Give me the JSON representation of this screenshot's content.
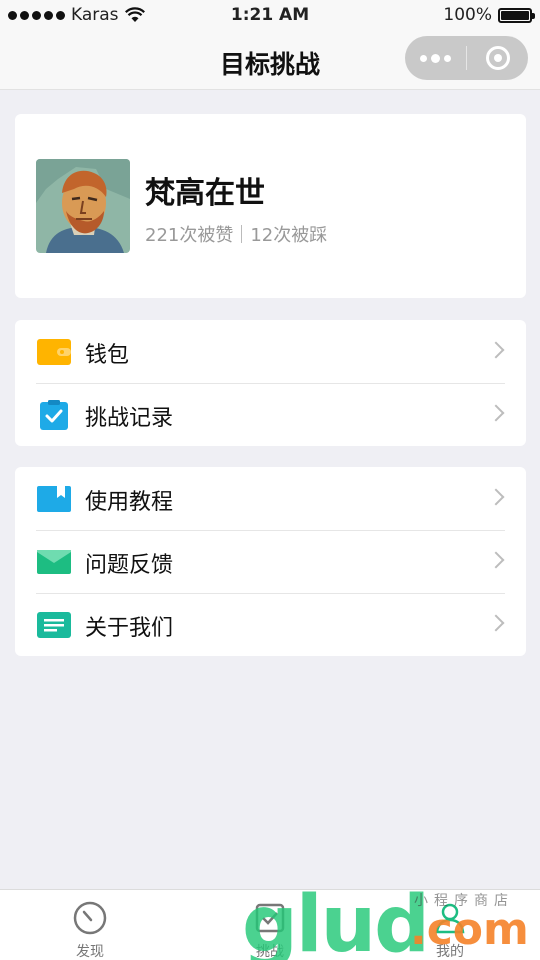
{
  "status_bar": {
    "carrier": "Karas",
    "time": "1:21 AM",
    "battery": "100%",
    "battery_level": 1.0
  },
  "nav": {
    "title": "目标挑战"
  },
  "profile": {
    "name": "梵高在世",
    "likes": "221次被赞",
    "dislikes": "12次被踩"
  },
  "menu_group_1": [
    {
      "label": "钱包",
      "icon": "wallet-icon",
      "color": "#ffb400"
    },
    {
      "label": "挑战记录",
      "icon": "clipboard-check-icon",
      "color": "#1eaae7"
    }
  ],
  "menu_group_2": [
    {
      "label": "使用教程",
      "icon": "book-icon",
      "color": "#1eaae7"
    },
    {
      "label": "问题反馈",
      "icon": "mail-icon",
      "color": "#1dbd82"
    },
    {
      "label": "关于我们",
      "icon": "document-icon",
      "color": "#1aba9c"
    }
  ],
  "tabbar": {
    "tabs": [
      {
        "label": "发现",
        "icon": "compass-icon"
      },
      {
        "label": "挑战",
        "icon": "checkbox-icon"
      },
      {
        "label": "我的",
        "icon": "user-icon"
      }
    ]
  },
  "watermark": {
    "brand": "glud",
    "domain": ".com",
    "tagline": "小程序商店"
  }
}
